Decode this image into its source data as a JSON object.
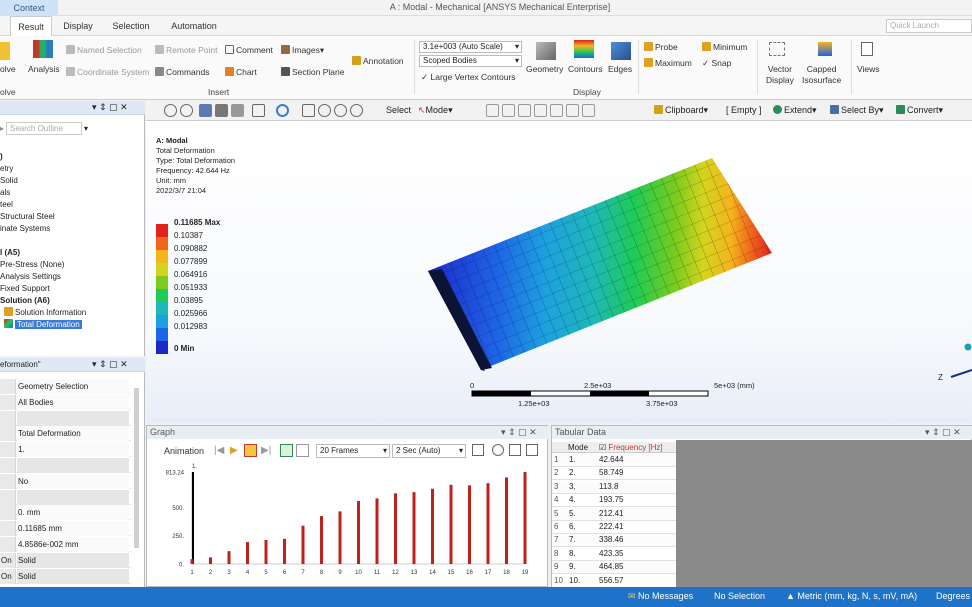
{
  "window": {
    "title": "A : Modal - Mechanical [ANSYS Mechanical Enterprise]",
    "context_tab": "Context"
  },
  "tabs": [
    "Result",
    "Display",
    "Selection",
    "Automation"
  ],
  "quick_launch": {
    "placeholder": "Quick Launch"
  },
  "ribbon": {
    "solve": "olve",
    "analysis": "Analysis",
    "named_selection": "Named Selection",
    "coordinate_system": "Coordinate System",
    "remote_point": "Remote Point",
    "commands": "Commands",
    "comment": "Comment",
    "chart": "Chart",
    "images": "Images",
    "section_plane": "Section Plane",
    "annotation": "Annotation",
    "scale": "3.1e+003 (Auto Scale)",
    "scoped": "Scoped Bodies",
    "large_vertex": "Large Vertex Contours",
    "geometry": "Geometry",
    "contours": "Contours",
    "edges": "Edges",
    "probe": "Probe",
    "maximum": "Maximum",
    "minimum": "Minimum",
    "snap": "Snap",
    "vector_display_1": "Vector",
    "vector_display_2": "Display",
    "capped_1": "Capped",
    "capped_2": "Isosurface",
    "views": "Views",
    "group_solve": "olve",
    "group_insert": "Insert",
    "group_display": "Display"
  },
  "toolbar": {
    "select": "Select",
    "mode": "Mode",
    "clipboard": "Clipboard",
    "empty": "[ Empty ]",
    "extend": "Extend",
    "select_by": "Select By",
    "convert": "Convert"
  },
  "outline": {
    "search_placeholder": "Search Outline",
    "items": [
      ")",
      "etry",
      "Solid",
      "als",
      "teel",
      "Structural Steel",
      "inate Systems",
      "l (A5)",
      "Pre-Stress (None)",
      "Analysis Settings",
      "Fixed Support",
      "Solution (A6)",
      "Solution Information",
      "Total Deformation"
    ]
  },
  "details": {
    "title": "eformation\"",
    "rows": [
      {
        "l": "",
        "v": "Geometry Selection"
      },
      {
        "l": "",
        "v": "All Bodies"
      },
      {
        "l": "",
        "v": ""
      },
      {
        "l": "",
        "v": "Total Deformation"
      },
      {
        "l": "",
        "v": "1."
      },
      {
        "l": "",
        "v": ""
      },
      {
        "l": "",
        "v": "No"
      },
      {
        "l": "",
        "v": ""
      },
      {
        "l": "",
        "v": "0. mm"
      },
      {
        "l": "",
        "v": "0.11685 mm"
      },
      {
        "l": "",
        "v": "4.8586e-002 mm"
      },
      {
        "l": "On",
        "v": "Solid"
      },
      {
        "l": "On",
        "v": "Solid"
      }
    ]
  },
  "viewport": {
    "info": [
      "A: Modal",
      "Total Deformation",
      "Type: Total Deformation",
      "Frequency: 42.644 Hz",
      "Unit: mm",
      "2022/3/7 21:04"
    ],
    "legend": [
      "0.11685 Max",
      "0.10387",
      "0.090882",
      "0.077899",
      "0.064916",
      "0.051933",
      "0.03895",
      "0.025966",
      "0.012983",
      "0 Min"
    ],
    "legend_colors": [
      "#e0231c",
      "#f0641e",
      "#f5b41e",
      "#d4d41e",
      "#7ccb1e",
      "#1ecb55",
      "#1eb8b8",
      "#1ea0e0",
      "#1e64e6",
      "#1e28c8"
    ],
    "scale_labels_top": [
      "0",
      "2.5e+03",
      "5e+03 (mm)"
    ],
    "scale_labels_bottom": [
      "1.25e+03",
      "3.75e+03"
    ],
    "axis": "Z"
  },
  "graph": {
    "title": "Graph",
    "animation": "Animation",
    "frames": "20 Frames",
    "duration": "2 Sec (Auto)",
    "top_label": "1.",
    "y_ticks": [
      "813.24",
      "500.",
      "250.",
      "0."
    ]
  },
  "chart_data": {
    "type": "bar",
    "categories": [
      "1",
      "2",
      "3",
      "4",
      "5",
      "6",
      "7",
      "8",
      "9",
      "10",
      "11",
      "12",
      "13",
      "14",
      "15",
      "16",
      "17",
      "18",
      "19"
    ],
    "values": [
      42.644,
      58.749,
      113.8,
      193.75,
      212.41,
      222.41,
      338.46,
      423.35,
      464.85,
      556.57,
      580,
      625,
      635,
      665,
      700,
      695,
      715,
      765,
      813.24
    ],
    "ylim": [
      0,
      813.24
    ],
    "title": "",
    "xlabel": "",
    "ylabel": ""
  },
  "tabular": {
    "title": "Tabular Data",
    "col_mode": "Mode",
    "col_freq": "Frequency [Hz]",
    "rows": [
      [
        "1",
        "1.",
        "42.644"
      ],
      [
        "2",
        "2.",
        "58.749"
      ],
      [
        "3",
        "3.",
        "113.8"
      ],
      [
        "4",
        "4.",
        "193.75"
      ],
      [
        "5",
        "5.",
        "212.41"
      ],
      [
        "6",
        "6.",
        "222.41"
      ],
      [
        "7",
        "7.",
        "338.46"
      ],
      [
        "8",
        "8.",
        "423.35"
      ],
      [
        "9",
        "9.",
        "464.85"
      ],
      [
        "10",
        "10.",
        "556.57"
      ]
    ]
  },
  "status": {
    "messages": "No Messages",
    "selection": "No Selection",
    "units": "Metric (mm, kg, N, s, mV, mA)",
    "degrees": "Degrees"
  }
}
